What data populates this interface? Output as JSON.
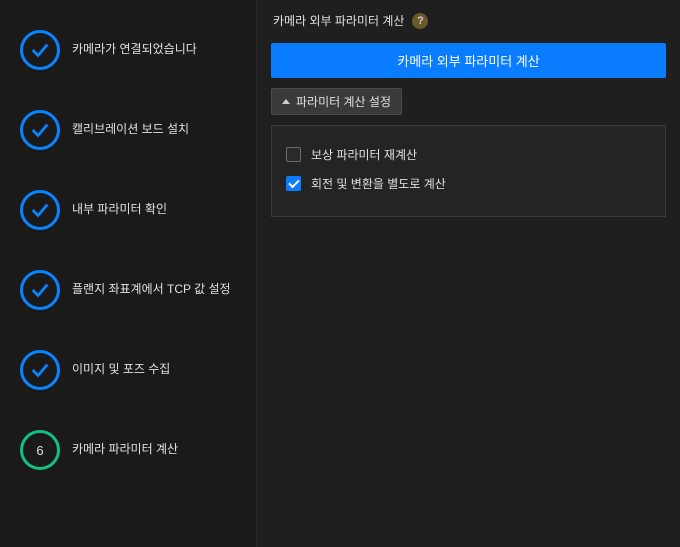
{
  "sidebar": {
    "steps": [
      {
        "label": "카메라가 연결되었습니다",
        "state": "done"
      },
      {
        "label": "캘리브레이션 보드 설치",
        "state": "done"
      },
      {
        "label": "내부 파라미터 확인",
        "state": "done"
      },
      {
        "label": "플랜지 좌표계에서 TCP 값 설정",
        "state": "done"
      },
      {
        "label": "이미지 및 포즈 수집",
        "state": "done"
      },
      {
        "label": "카메라 파라미터 계산",
        "state": "current",
        "number": "6"
      }
    ]
  },
  "main": {
    "section_title": "카메라 외부 파라미터 계산",
    "help_glyph": "?",
    "primary_button": "카메라 외부 파라미터 계산",
    "collapse_label": "파라미터 계산 설정",
    "options": [
      {
        "label": "보상 파라미터 재계산",
        "checked": false
      },
      {
        "label": "회전 및 변환을 별도로 계산",
        "checked": true
      }
    ]
  }
}
